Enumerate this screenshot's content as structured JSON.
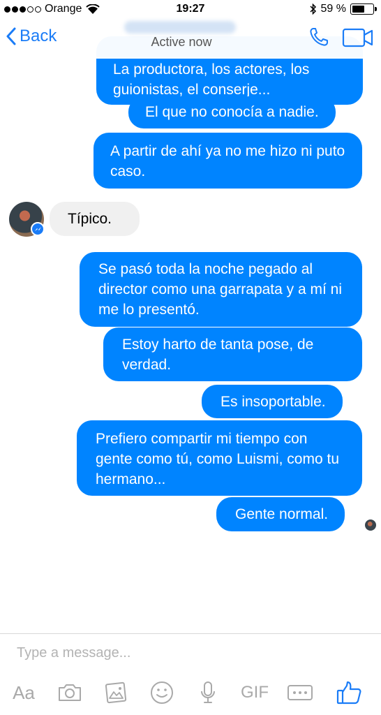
{
  "status_bar": {
    "carrier": "Orange",
    "time": "19:27",
    "battery_text": "59 %",
    "battery_level": 0.59
  },
  "header": {
    "back_label": "Back",
    "subtitle": "Active now",
    "icons": [
      "chevron-left-icon",
      "phone-icon",
      "video-camera-icon"
    ]
  },
  "messages": [
    {
      "direction": "outgoing",
      "text": "La productora, los actores, los guionistas, el conserje..."
    },
    {
      "direction": "outgoing",
      "text": "El que no conocía a nadie."
    },
    {
      "direction": "outgoing",
      "text": "A partir de ahí ya no me hizo ni puto caso."
    },
    {
      "direction": "incoming",
      "text": "Típico."
    },
    {
      "direction": "outgoing",
      "text": "Se pasó toda la noche pegado al director como una garrapata y a mí ni me lo presentó."
    },
    {
      "direction": "outgoing",
      "text": "Estoy harto de tanta pose, de verdad."
    },
    {
      "direction": "outgoing",
      "text": "Es insoportable."
    },
    {
      "direction": "outgoing",
      "text": "Prefiero compartir mi tiempo con gente como tú, como Luismi, como tu hermano..."
    },
    {
      "direction": "outgoing",
      "text": "Gente normal."
    }
  ],
  "composer": {
    "placeholder": "Type a message...",
    "text_format_label": "Aa",
    "gif_label": "GIF"
  },
  "colors": {
    "accent": "#1a7cf7",
    "outgoing_bubble": "#0084ff",
    "incoming_bubble": "#f0f0f0"
  }
}
